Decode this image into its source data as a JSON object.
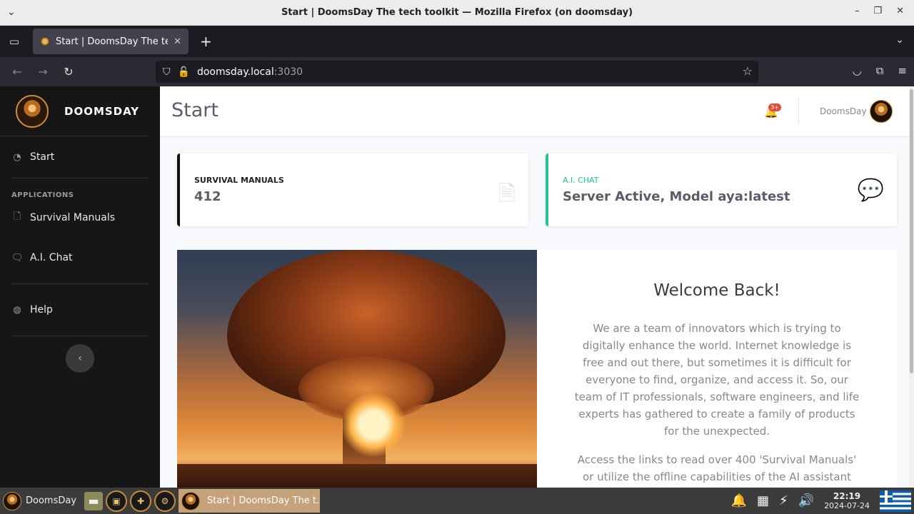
{
  "window": {
    "title": "Start | DoomsDay The tech toolkit — Mozilla Firefox (on doomsday)",
    "menu_icon": "chevron-down-icon",
    "win_controls": [
      "–",
      "❐",
      "✕"
    ]
  },
  "browser": {
    "tab_title": "Start | DoomsDay The tech toolkit",
    "tab_close": "✕",
    "new_tab": "+",
    "url_host": "doomsday.local",
    "url_port": ":3030"
  },
  "sidebar": {
    "brand": "DOOMSDAY",
    "start_label": "Start",
    "section_heading": "APPLICATIONS",
    "items": [
      {
        "label": "Survival Manuals",
        "icon": "file-icon"
      },
      {
        "label": "A.I. Chat",
        "icon": "chat-icon"
      },
      {
        "label": "Help",
        "icon": "globe-icon"
      }
    ],
    "collapse_icon": "‹"
  },
  "topbar": {
    "page_title": "Start",
    "notification_count": "3+",
    "username": "DoomsDay"
  },
  "cards": [
    {
      "label": "SURVIVAL MANUALS",
      "value": "412",
      "accent": "#111111"
    },
    {
      "label": "A.I. CHAT",
      "value": "Server Active, Model aya:latest",
      "accent": "#1cc88a"
    }
  ],
  "hero": {
    "title": "Welcome Back!",
    "paragraph1": "We are a team of innovators which is trying to digitally enhance the world. Internet knowledge is free and out there, but sometimes it is difficult for everyone to find, organize, and access it. So, our team of IT professionals, software engineers, and life experts has gathered to create a family of products for the unexpected.",
    "paragraph2": "Access the links to read over 400 'Survival Manuals' or utilize the offline capabilities of the AI assistant"
  },
  "taskbar": {
    "start_label": "DoomsDay",
    "task_label": "Start | DoomsDay The t...",
    "time": "22:19",
    "date": "2024-07-24"
  }
}
